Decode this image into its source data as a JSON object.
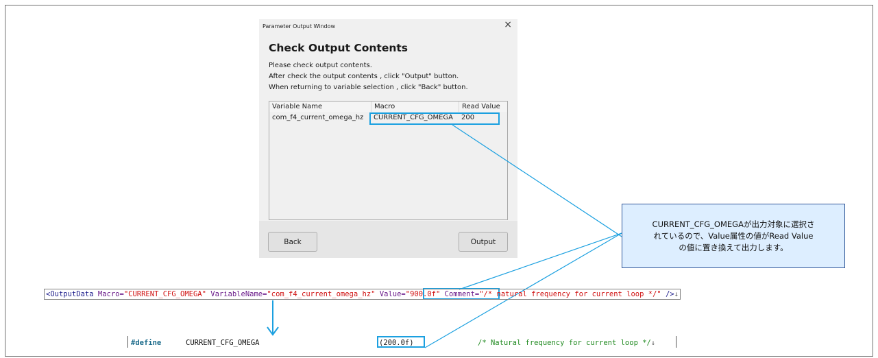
{
  "dialog": {
    "window_title": "Parameter Output Window",
    "close_glyph": "×",
    "heading": "Check Output Contents",
    "messages": [
      "Please check output contents.",
      "After check the output contents , click \"Output\" button.",
      "When returning to variable selection , click \"Back\" button."
    ],
    "table": {
      "headers": [
        "Variable Name",
        "Macro",
        "Read Value"
      ],
      "rows": [
        [
          "com_f4_current_omega_hz",
          "CURRENT_CFG_OMEGA",
          "200"
        ]
      ]
    },
    "back_label": "Back",
    "output_label": "Output"
  },
  "callout": {
    "lines": [
      "CURRENT_CFG_OMEGAが出力対象に選択さ",
      "れているので、Value属性の値がRead Value",
      "の値に置き換えて出力します。"
    ]
  },
  "xml": {
    "open": "<OutputData",
    "macro_attr": "Macro=",
    "macro_val": "\"CURRENT_CFG_OMEGA\"",
    "var_attr": "VariableName=",
    "var_val": "\"com_f4_current_omega_hz\"",
    "value_attr": "Value=",
    "value_val": "\"900.0f\"",
    "comment_attr": "Comment=",
    "comment_val": "\"/* natural frequency for current loop */\"",
    "close": "/>",
    "newline_mark": "↓"
  },
  "define": {
    "keyword": "#define",
    "macro": "CURRENT_CFG_OMEGA",
    "value": "(200.0f)",
    "comment": "/* Natural frequency for current loop */",
    "newline_mark": "↓"
  },
  "colors": {
    "highlight": "#1ba0e0",
    "callout_fill": "#ddeeff",
    "callout_border": "#2f5597",
    "define_keyword": "#1a6a8a",
    "comment_green": "#228b22"
  }
}
